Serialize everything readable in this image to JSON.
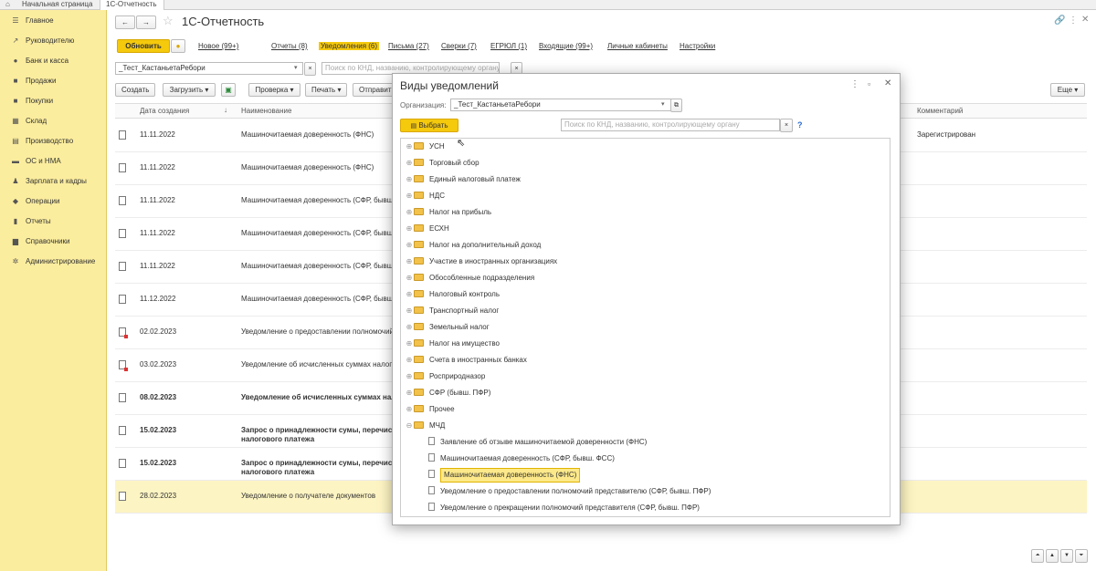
{
  "tabs": [
    {
      "label": "Начальная страница"
    },
    {
      "label": "1С-Отчетность"
    }
  ],
  "sidebar": {
    "items": [
      {
        "icon": "menu-icon",
        "glyph": "☰",
        "label": "Главное"
      },
      {
        "icon": "trend-icon",
        "glyph": "↗",
        "label": "Руководителю"
      },
      {
        "icon": "bank-icon",
        "glyph": "●",
        "label": "Банк и касса"
      },
      {
        "icon": "sales-icon",
        "glyph": "■",
        "label": "Продажи"
      },
      {
        "icon": "purchases-icon",
        "glyph": "■",
        "label": "Покупки"
      },
      {
        "icon": "warehouse-icon",
        "glyph": "▦",
        "label": "Склад"
      },
      {
        "icon": "production-icon",
        "glyph": "▤",
        "label": "Производство"
      },
      {
        "icon": "truck-icon",
        "glyph": "▬",
        "label": "ОС и НМА"
      },
      {
        "icon": "salary-icon",
        "glyph": "♟",
        "label": "Зарплата и кадры"
      },
      {
        "icon": "operations-icon",
        "glyph": "◆",
        "label": "Операции"
      },
      {
        "icon": "reports-icon",
        "glyph": "▮",
        "label": "Отчеты"
      },
      {
        "icon": "reference-icon",
        "glyph": "▆",
        "label": "Справочники"
      },
      {
        "icon": "admin-gear-icon",
        "glyph": "✲",
        "label": "Администрирование"
      }
    ]
  },
  "header": {
    "title": "1С-Отчетность"
  },
  "toolbar": {
    "refresh": "Обновить",
    "links": [
      "Новое (99+)",
      "Отчеты (8)",
      "Уведомления (6)",
      "Письма (27)",
      "Сверки (7)",
      "ЕГРЮЛ (1)",
      "Входящие (99+)",
      "Личные кабинеты",
      "Настройки"
    ]
  },
  "filter": {
    "org": "_Тест_КастаньетаРебори",
    "search_placeholder": "Поиск по КНД, названию, контролирующему органу"
  },
  "actions": {
    "create": "Создать",
    "load": "Загрузить",
    "check": "Проверка",
    "print": "Печать",
    "send": "Отправить",
    "more": "Еще"
  },
  "table": {
    "headers": {
      "date": "Дата создания",
      "name": "Наименование",
      "comment": "Комментарий"
    },
    "rows": [
      {
        "date": "11.11.2022",
        "name": "Машиночитаемая доверенность (ФНС)",
        "name2": "",
        "comment": "Зарегистрирован",
        "bold": false,
        "red": false,
        "sel": false
      },
      {
        "date": "11.11.2022",
        "name": "Машиночитаемая доверенность (ФНС)",
        "name2": "",
        "comment": "",
        "bold": false,
        "red": false,
        "sel": false
      },
      {
        "date": "11.11.2022",
        "name": "Машиночитаемая доверенность (СФР, бывш. ФСС)",
        "name2": "",
        "comment": "",
        "bold": false,
        "red": false,
        "sel": false
      },
      {
        "date": "11.11.2022",
        "name": "Машиночитаемая доверенность (СФР, бывш. ФСС)",
        "name2": "",
        "comment": "",
        "bold": false,
        "red": false,
        "sel": false
      },
      {
        "date": "11.11.2022",
        "name": "Машиночитаемая доверенность (СФР, бывш. ФСС)",
        "name2": "",
        "comment": "",
        "bold": false,
        "red": false,
        "sel": false
      },
      {
        "date": "11.12.2022",
        "name": "Машиночитаемая доверенность (СФР, бывш. ФСС)",
        "name2": "",
        "comment": "",
        "bold": false,
        "red": false,
        "sel": false
      },
      {
        "date": "02.02.2023",
        "name": "Уведомление о предоставлении полномочий представителю",
        "name2": "",
        "comment": "",
        "bold": false,
        "red": true,
        "sel": false
      },
      {
        "date": "03.02.2023",
        "name": "Уведомление об исчисленных суммах налогов",
        "name2": "",
        "comment": "",
        "bold": false,
        "red": true,
        "sel": false
      },
      {
        "date": "08.02.2023",
        "name": "Уведомление об исчисленных суммах налогов",
        "name2": "",
        "comment": "",
        "bold": true,
        "red": false,
        "sel": false
      },
      {
        "date": "15.02.2023",
        "name": "Запрос о принадлежности сумы, перечисленной",
        "name2": "налогового платежа",
        "comment": "",
        "bold": true,
        "red": false,
        "sel": false
      },
      {
        "date": "15.02.2023",
        "name": "Запрос о принадлежности сумы, перечисленной",
        "name2": "налогового платежа",
        "comment": "",
        "bold": true,
        "red": false,
        "sel": false
      },
      {
        "date": "28.02.2023",
        "name": "Уведомление о получателе документов",
        "name2": "",
        "comment": "",
        "bold": false,
        "red": false,
        "sel": true
      }
    ]
  },
  "dialog": {
    "title": "Виды уведомлений",
    "org_label": "Организация:",
    "org": "_Тест_КастаньетаРебори",
    "select": "Выбрать",
    "search_placeholder": "Поиск по КНД, названию, контролирующему органу",
    "help": "?",
    "folders": [
      "УСН",
      "Торговый сбор",
      "Единый налоговый платеж",
      "НДС",
      "Налог на прибыль",
      "ЕСХН",
      "Налог на дополнительный доход",
      "Участие в иностранных организациях",
      "Обособленные подразделения",
      "Налоговый контроль",
      "Транспортный налог",
      "Земельный налог",
      "Налог на имущество",
      "Счета в иностранных банках",
      "Росприродназор",
      "СФР (бывш. ПФР)",
      "Прочее",
      "МЧД"
    ],
    "children": [
      {
        "label": "Заявление об отзыве машиночитаемой доверенности (ФНС)",
        "sel": false
      },
      {
        "label": "Машиночитаемая доверенность (СФР, бывш. ФСС)",
        "sel": false
      },
      {
        "label": "Машиночитаемая доверенность (ФНС)",
        "sel": true
      },
      {
        "label": "Уведомление о предоставлении полномочий представителю (СФР, бывш. ПФР)",
        "sel": false
      },
      {
        "label": "Уведомление о прекращении полномочий представителя (СФР, бывш. ПФР)",
        "sel": false
      }
    ]
  },
  "colors": {
    "accent": "#f5c90c",
    "sidebar": "#fbed9e",
    "selection": "#fdf4c3"
  }
}
